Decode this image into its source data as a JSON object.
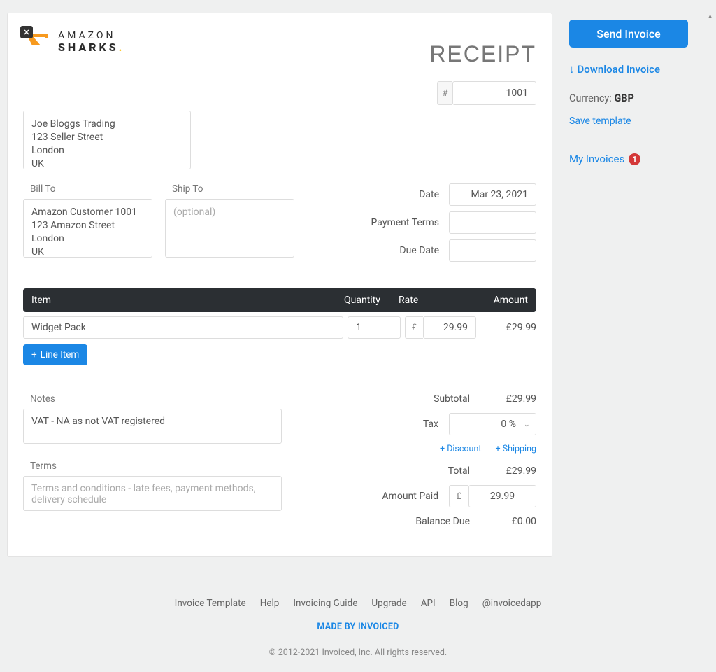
{
  "logo": {
    "l1": "AMAZON",
    "l2": "SHARKS"
  },
  "title": "RECEIPT",
  "from": "Joe Bloggs Trading\n123 Seller Street\nLondon\nUK",
  "numberHash": "#",
  "number": "1001",
  "billToLabel": "Bill To",
  "shipToLabel": "Ship To",
  "billTo": "Amazon Customer 1001\n123 Amazon Street\nLondon\nUK",
  "shipTo": "",
  "shipToPlaceholder": "(optional)",
  "meta": {
    "dateLabel": "Date",
    "date": "Mar 23, 2021",
    "paymentTermsLabel": "Payment Terms",
    "paymentTerms": "",
    "dueDateLabel": "Due Date",
    "dueDate": ""
  },
  "columns": {
    "item": "Item",
    "qty": "Quantity",
    "rate": "Rate",
    "amount": "Amount"
  },
  "items": [
    {
      "desc": "Widget Pack",
      "qty": "1",
      "currency": "£",
      "rate": "29.99",
      "amount": "£29.99"
    }
  ],
  "lineItemBtn": "Line Item",
  "notesLabel": "Notes",
  "notes": "VAT - NA as not VAT registered",
  "termsLabel": "Terms",
  "termsPlaceholder": "Terms and conditions - late fees, payment methods, delivery schedule",
  "totals": {
    "subtotalLabel": "Subtotal",
    "subtotal": "£29.99",
    "taxLabel": "Tax",
    "tax": "0 %",
    "discountLink": "Discount",
    "shippingLink": "Shipping",
    "totalLabel": "Total",
    "total": "£29.99",
    "amountPaidLabel": "Amount Paid",
    "paidCurrency": "£",
    "amountPaid": "29.99",
    "balanceDueLabel": "Balance Due",
    "balanceDue": "£0.00"
  },
  "side": {
    "send": "Send Invoice",
    "download": "Download Invoice",
    "currencyLabel": "Currency:",
    "currency": "GBP",
    "saveTemplate": "Save template",
    "myInvoices": "My Invoices",
    "badge": "1"
  },
  "footer": {
    "links": [
      "Invoice Template",
      "Help",
      "Invoicing Guide",
      "Upgrade",
      "API",
      "Blog",
      "@invoicedapp"
    ],
    "madeBy": "MADE BY INVOICED",
    "copyright": "© 2012-2021 Invoiced, Inc. All rights reserved."
  }
}
